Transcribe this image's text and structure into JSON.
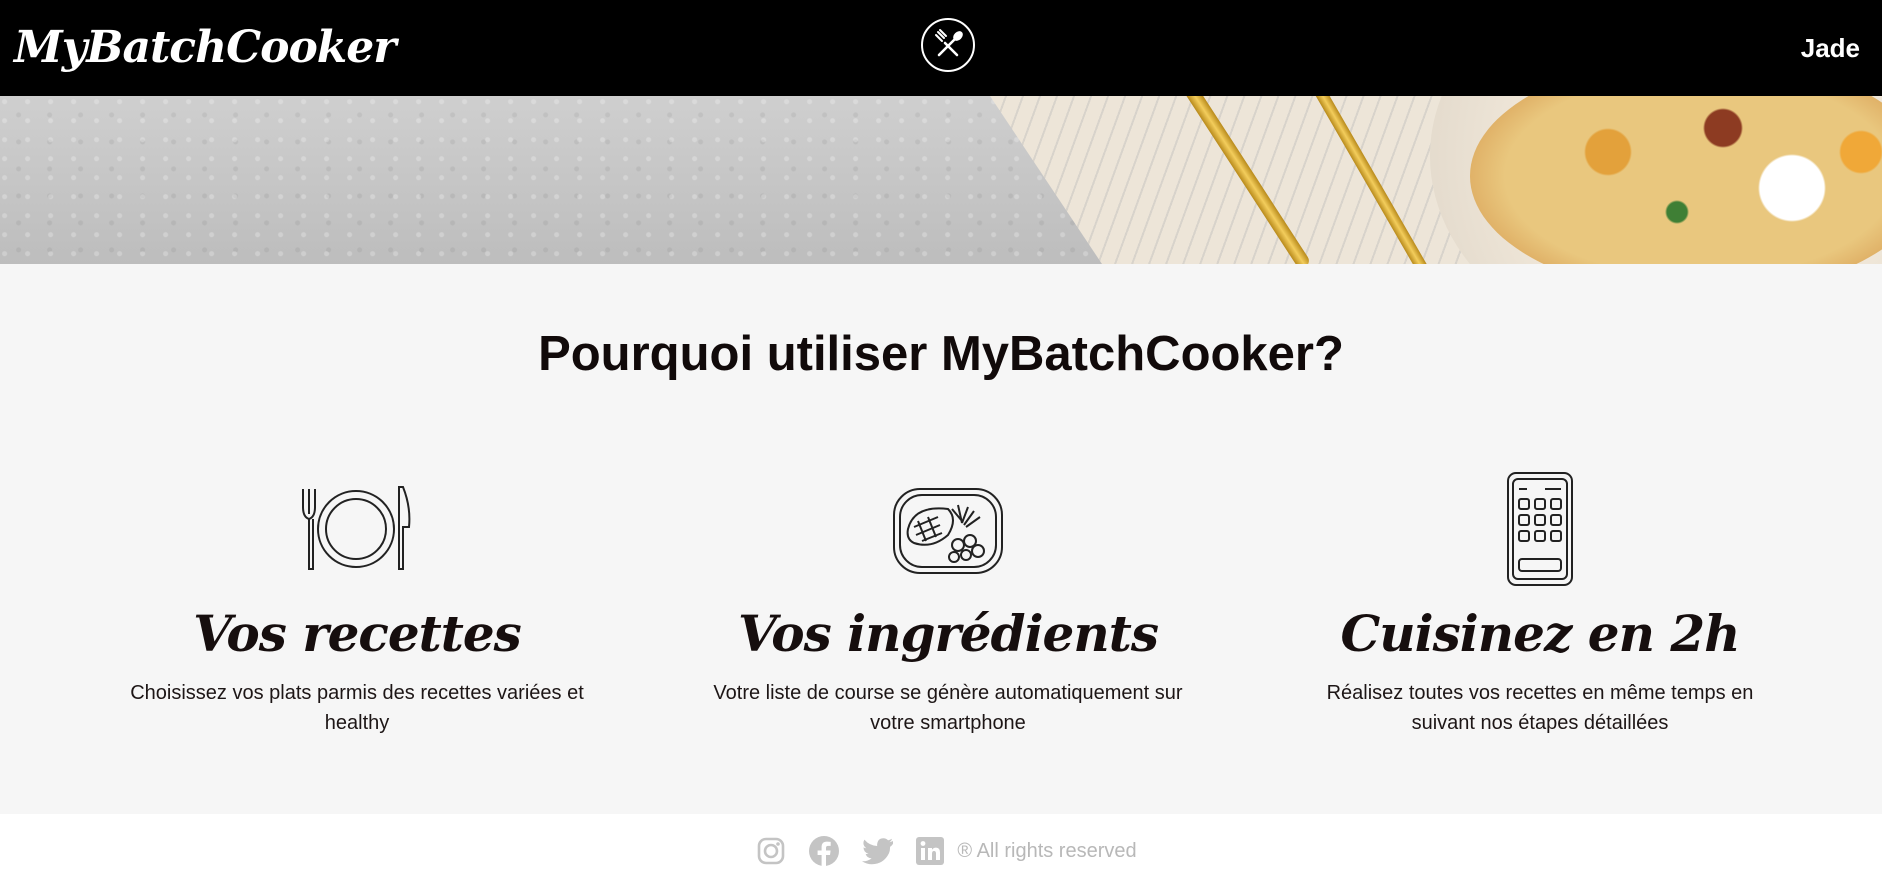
{
  "header": {
    "logo": "MyBatchCooker",
    "center_icon": "fork-spoon-icon",
    "user_name": "Jade"
  },
  "banner": {
    "image": "food-plate-banner"
  },
  "main": {
    "title": "Pourquoi utiliser MyBatchCooker?",
    "features": [
      {
        "icon": "plate-cutlery-icon",
        "title": "Vos recettes",
        "text": "Choisissez vos plats parmis des recettes variées et healthy"
      },
      {
        "icon": "meal-tray-icon",
        "title": "Vos ingrédients",
        "text": "Votre liste de course se génère automatiquement sur votre smartphone"
      },
      {
        "icon": "smartphone-icon",
        "title": "Cuisinez en 2h",
        "text": "Réalisez toutes vos recettes en même temps en suivant nos étapes détaillées"
      }
    ]
  },
  "footer": {
    "socials": [
      "instagram-icon",
      "facebook-icon",
      "twitter-icon",
      "linkedin-icon"
    ],
    "copyright": "® All rights reserved",
    "icon_color": "#c4c4c4"
  }
}
